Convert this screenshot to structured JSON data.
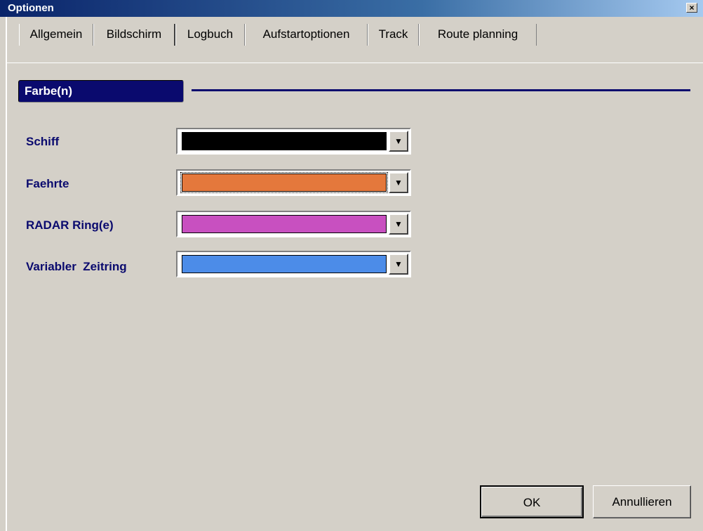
{
  "window": {
    "title": "Optionen",
    "close_glyph": "×"
  },
  "tabs": [
    {
      "label": "Allgemein",
      "active": false
    },
    {
      "label": "Bildschirm",
      "active": true
    },
    {
      "label": "Logbuch",
      "active": false
    },
    {
      "label": "Aufstartoptionen",
      "active": false
    },
    {
      "label": "Track",
      "active": false
    },
    {
      "label": "Route planning",
      "active": false
    }
  ],
  "section": {
    "title": "Farbe(n)"
  },
  "colors": [
    {
      "label": "Schiff",
      "value": "#000000"
    },
    {
      "label": "Faehrte",
      "value": "#e4783c"
    },
    {
      "label": "RADAR Ring(e)",
      "value": "#c850c0"
    },
    {
      "label": "Variabler  Zeitring",
      "value": "#4c8ce8"
    }
  ],
  "buttons": {
    "ok": "OK",
    "cancel": "Annullieren"
  },
  "icons": {
    "dropdown": "chevron-down-icon",
    "close": "close-icon"
  },
  "theme": {
    "titlebar_start": "#0a246a",
    "accent": "#0a0a6e",
    "face": "#d4d0c8"
  }
}
